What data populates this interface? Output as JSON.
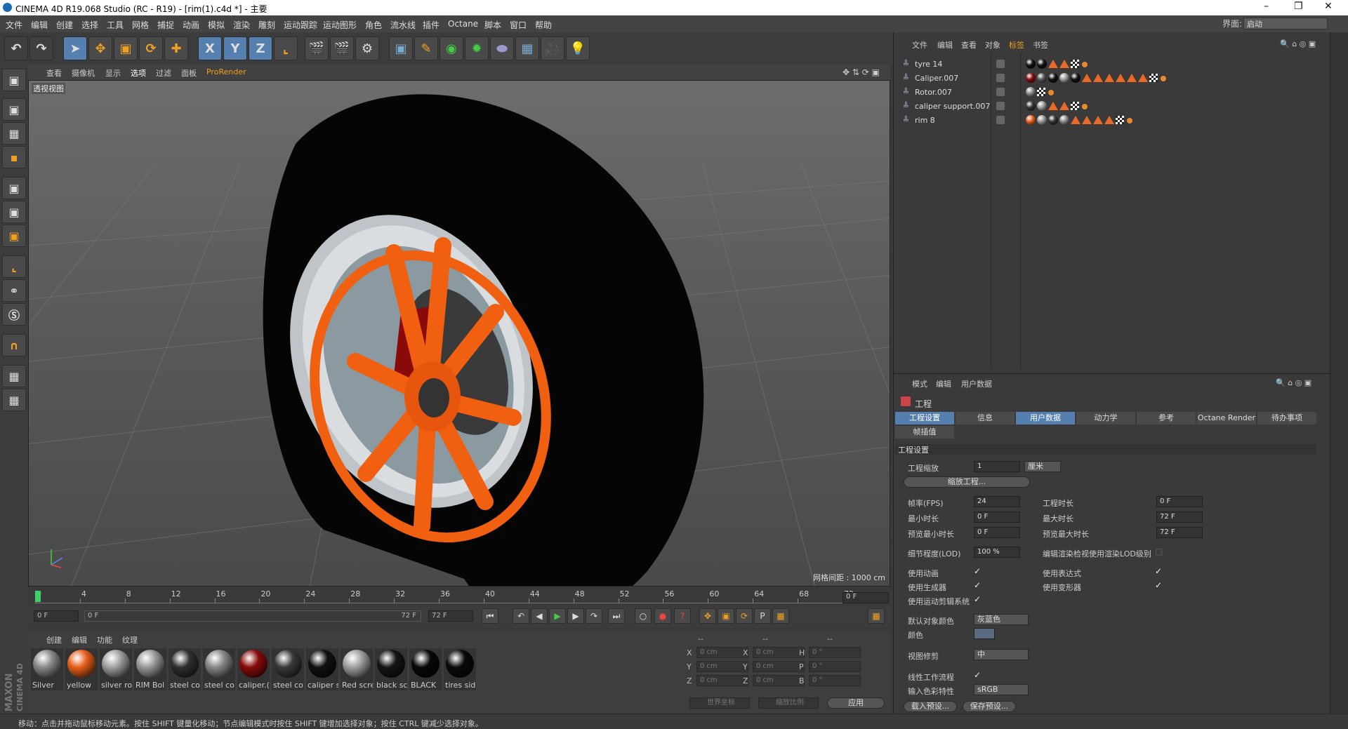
{
  "window": {
    "title": "CINEMA 4D R19.068 Studio (RC - R19) - [rim(1).c4d *] - 主要"
  },
  "menu": [
    "文件",
    "编辑",
    "创建",
    "选择",
    "工具",
    "网格",
    "捕捉",
    "动画",
    "模拟",
    "渲染",
    "雕刻",
    "运动跟踪",
    "运动图形",
    "角色",
    "流水线",
    "插件",
    "Octane",
    "脚本",
    "窗口",
    "帮助"
  ],
  "layout": {
    "label": "界面:",
    "value": "启动"
  },
  "toolbar": {
    "x": "X",
    "y": "Y",
    "z": "Z"
  },
  "viewport": {
    "menu": [
      "查看",
      "摄像机",
      "显示",
      "选项",
      "过滤",
      "面板",
      "ProRender"
    ],
    "label": "透视视图",
    "grid_info": "网格间距 : 1000 cm"
  },
  "timeline": {
    "ticks": [
      "0",
      "4",
      "8",
      "12",
      "16",
      "20",
      "24",
      "28",
      "32",
      "36",
      "40",
      "44",
      "48",
      "52",
      "56",
      "60",
      "64",
      "68",
      "72"
    ],
    "current": "0 F",
    "start": "0 F",
    "range_start": "0 F",
    "range_end": "72 F",
    "end": "72 F"
  },
  "materials": {
    "menu": [
      "创建",
      "编辑",
      "功能",
      "纹理"
    ],
    "items": [
      {
        "name": "Silver",
        "color": "#8a8a8a"
      },
      {
        "name": "yellow",
        "color": "#e8601a"
      },
      {
        "name": "silver ro",
        "color": "#a0a0a0"
      },
      {
        "name": "RIM Bol",
        "color": "#9a9a9a"
      },
      {
        "name": "steel co",
        "color": "#303030"
      },
      {
        "name": "steel co",
        "color": "#888888"
      },
      {
        "name": "caliper.(",
        "color": "#8a0a0a"
      },
      {
        "name": "steel co",
        "color": "#3a3a3a"
      },
      {
        "name": "caliper s",
        "color": "#111111"
      },
      {
        "name": "Red scre",
        "color": "#a0a0a0"
      },
      {
        "name": "black sc",
        "color": "#151515"
      },
      {
        "name": "BLACK",
        "color": "#080808"
      },
      {
        "name": "tires sid",
        "color": "#0a0a0a"
      }
    ]
  },
  "coords": {
    "header": [
      "--",
      "--",
      "--"
    ],
    "rows": [
      {
        "a": "X",
        "av": "0 cm",
        "b": "X",
        "bv": "0 cm",
        "c": "H",
        "cv": "0 °"
      },
      {
        "a": "Y",
        "av": "0 cm",
        "b": "Y",
        "bv": "0 cm",
        "c": "P",
        "cv": "0 °"
      },
      {
        "a": "Z",
        "av": "0 cm",
        "b": "Z",
        "bv": "0 cm",
        "c": "B",
        "cv": "0 °"
      }
    ],
    "mode1": "世界坐标",
    "mode2": "缩放比例",
    "apply": "应用"
  },
  "brand": {
    "line1": "MAXON",
    "line2": "CINEMA 4D"
  },
  "status": "移动：点击并拖动鼠标移动元素。按住 SHIFT 键量化移动；节点编辑模式时按住 SHIFT 键增加选择对象；按住 CTRL 键减少选择对象。",
  "objects": {
    "menu": [
      "文件",
      "编辑",
      "查看",
      "对象",
      "标签",
      "书签"
    ],
    "rows": [
      {
        "name": "tyre 14",
        "tags": [
          "#111",
          "#111",
          "tri",
          "tri",
          "chk",
          "dot"
        ]
      },
      {
        "name": "Caliper.007",
        "tags": [
          "#8a0a0a",
          "#555",
          "#111",
          "#999",
          "#111",
          "tri",
          "tri",
          "tri",
          "tri",
          "tri",
          "tri",
          "chk",
          "dot"
        ]
      },
      {
        "name": "Rotor.007",
        "tags": [
          "#888",
          "chk",
          "dot"
        ]
      },
      {
        "name": "caliper support.007",
        "tags": [
          "#333",
          "#999",
          "tri",
          "tri",
          "chk",
          "dot"
        ]
      },
      {
        "name": "rim 8",
        "tags": [
          "#e8601a",
          "#999",
          "#333",
          "#888",
          "tri",
          "tri",
          "tri",
          "tri",
          "chk",
          "dot"
        ]
      }
    ]
  },
  "attributes": {
    "menu": [
      "模式",
      "编辑",
      "用户数据"
    ],
    "title": "工程",
    "tabs": [
      "工程设置",
      "信息",
      "用户数据",
      "动力学",
      "参考",
      "Octane Render",
      "待办事项"
    ],
    "tab2": "帧插值",
    "section": "工程设置",
    "scale_label": "工程缩放",
    "scale_value": "1",
    "scale_unit": "厘米",
    "scale_btn": "缩放工程...",
    "fps_label": "帧率(FPS)",
    "fps_value": "24",
    "duration_label": "工程时长",
    "duration_value": "0 F",
    "min_label": "最小时长",
    "min_value": "0 F",
    "max_label": "最大时长",
    "max_value": "72 F",
    "pmin_label": "预览最小时长",
    "pmin_value": "0 F",
    "pmax_label": "预览最大时长",
    "pmax_value": "72 F",
    "lod_label": "细节程度(LOD)",
    "lod_value": "100 %",
    "lod_render_label": "编辑渲染检视使用渲染LOD级别",
    "anim_label": "使用动画",
    "expr_label": "使用表达式",
    "gen_label": "使用生成器",
    "deform_label": "使用变形器",
    "motion_label": "使用运动剪辑系统",
    "defcolor_label": "默认对象颜色",
    "defcolor_value": "灰蓝色",
    "color_label": "颜色",
    "clip_label": "视图修剪",
    "clip_value": "中",
    "linear_label": "线性工作流程",
    "input_label": "输入色彩特性",
    "input_value": "sRGB",
    "load_btn": "载入预设...",
    "save_btn": "保存预设..."
  }
}
